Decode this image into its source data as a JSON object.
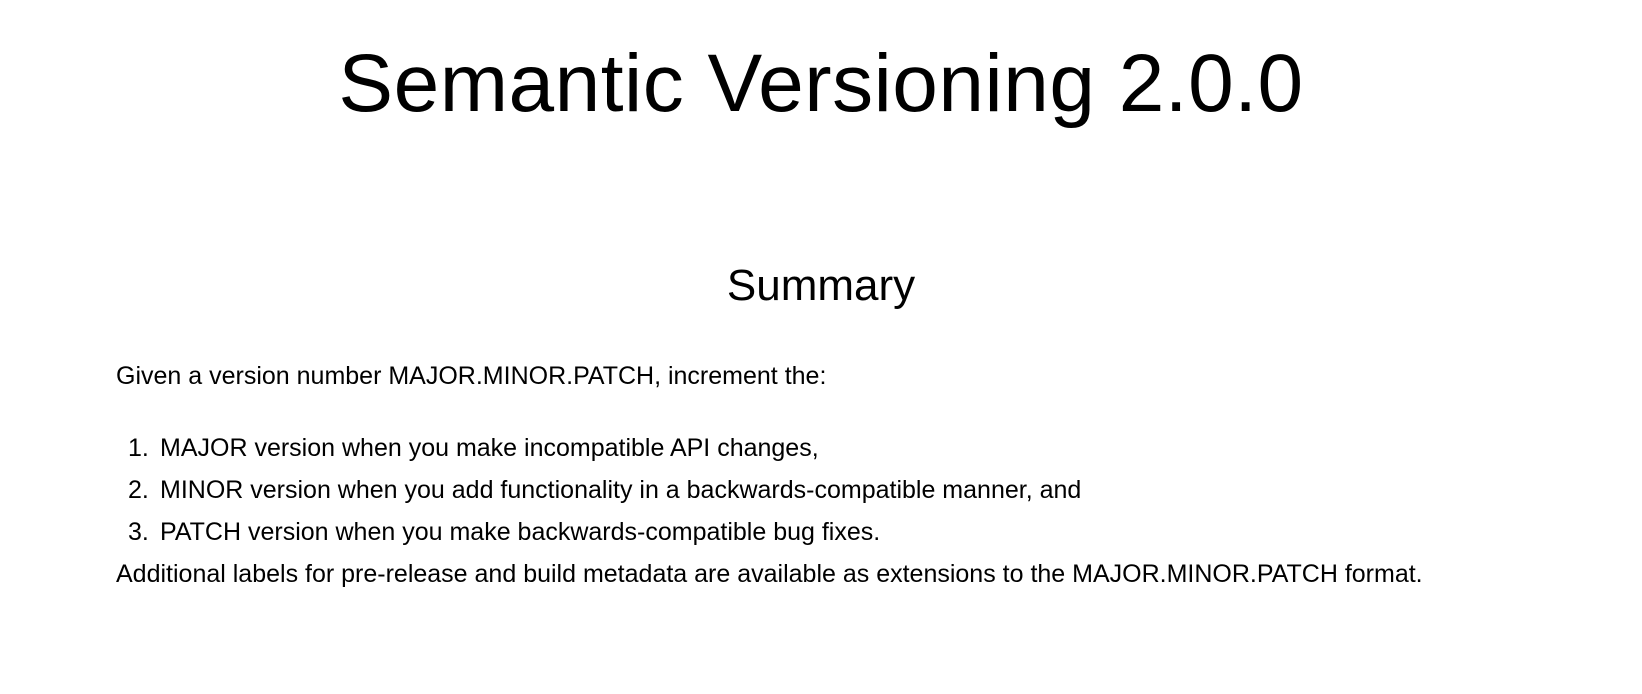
{
  "document": {
    "title": "Semantic Versioning 2.0.0",
    "summary_heading": "Summary",
    "intro": "Given a version number MAJOR.MINOR.PATCH, increment the:",
    "rules": [
      {
        "number": "1.",
        "text": "MAJOR version when you make incompatible API changes,"
      },
      {
        "number": "2.",
        "text": "MINOR version when you add functionality in a backwards-compatible manner, and"
      },
      {
        "number": "3.",
        "text": "PATCH version when you make backwards-compatible bug fixes."
      }
    ],
    "closing": "Additional labels for pre-release and build metadata are available as extensions to the MAJOR.MINOR.PATCH format."
  }
}
